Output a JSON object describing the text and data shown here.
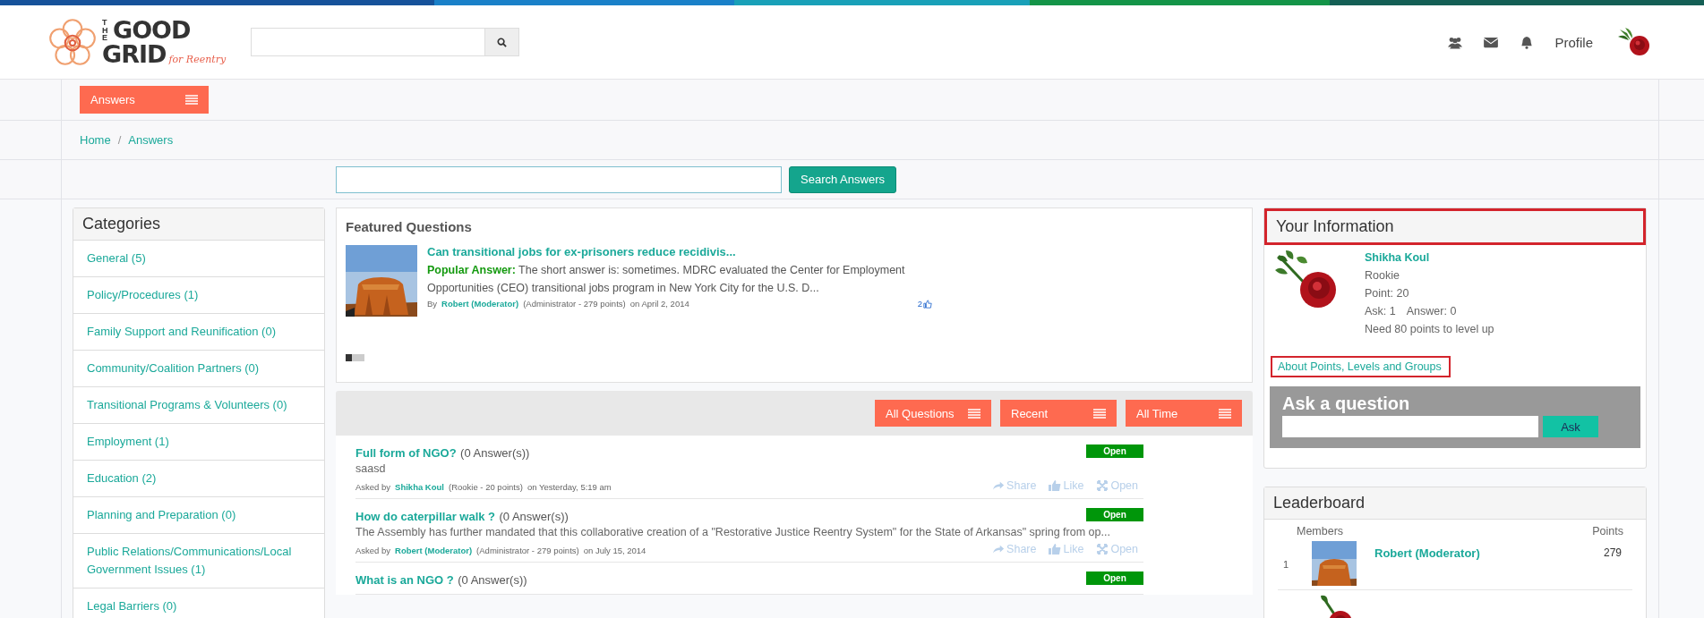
{
  "brand": {
    "top": "THE",
    "word1": "GOOD",
    "word2": "GRID",
    "tagline": "for Reentry"
  },
  "nav": {
    "profile": "Profile"
  },
  "section_button": {
    "label": "Answers"
  },
  "breadcrumb": {
    "separator": "/",
    "items": [
      "Home",
      "Answers"
    ]
  },
  "answer_search": {
    "button": "Search Answers"
  },
  "categories": {
    "title": "Categories",
    "items": [
      {
        "label": "General (5)"
      },
      {
        "label": "Policy/Procedures (1)"
      },
      {
        "label": "Family Support and Reunification (0)"
      },
      {
        "label": "Community/Coalition Partners (0)"
      },
      {
        "label": "Transitional Programs & Volunteers (0)"
      },
      {
        "label": "Employment (1)"
      },
      {
        "label": "Education (2)"
      },
      {
        "label": "Planning and Preparation (0)"
      },
      {
        "label": "Public Relations/Communications/Local Government Issues (1)"
      },
      {
        "label": "Legal Barriers (0)"
      }
    ]
  },
  "featured": {
    "title": "Featured Questions",
    "question": "Can transitional jobs for ex-prisoners reduce recidivis...",
    "answer_label": "Popular Answer:",
    "answer": "The short answer is: sometimes. MDRC evaluated the Center for Employment Opportunities (CEO) transitional jobs program in New York City for the U.S. D...",
    "by": "By",
    "author": "Robert (Moderator)",
    "role": "(Administrator - 279 points)",
    "date": "on April 2, 2014",
    "likes": "2",
    "pager": [
      {
        "selected": true
      },
      {
        "selected": false
      },
      {
        "selected": false
      }
    ]
  },
  "filters": [
    {
      "label": "All Questions"
    },
    {
      "label": "Recent"
    },
    {
      "label": "All Time"
    }
  ],
  "questions": [
    {
      "title": "Full form of NGO?",
      "count": "(0 Answer(s))",
      "excerpt": "saasd",
      "asked": "Asked by",
      "author": "Shikha Koul",
      "role": "(Rookie - 20 points)",
      "date": "on Yesterday, 5:19 am",
      "status": "Open",
      "actions": [
        "Share",
        "Like",
        "Open"
      ]
    },
    {
      "title": "How do caterpillar walk ?",
      "count": "(0 Answer(s))",
      "excerpt": "The Assembly has further mandated that this collaborative creation of a \"Restorative Justice Reentry System\" for the State of Arkansas\" spring from op...",
      "asked": "Asked by",
      "author": "Robert (Moderator)",
      "role": "(Administrator - 279 points)",
      "date": "on July 15, 2014",
      "status": "Open",
      "actions": [
        "Share",
        "Like",
        "Open"
      ]
    },
    {
      "title": "What is an NGO ?",
      "count": "(0 Answer(s))",
      "status": "Open"
    }
  ],
  "your_info": {
    "title": "Your Information",
    "name": "Shikha Koul",
    "level": "Rookie",
    "points": "Point: 20",
    "ask": "Ask: 1",
    "answer": "Answer: 0",
    "need": "Need 80 points to level up",
    "about": "About Points, Levels and Groups"
  },
  "ask_box": {
    "title": "Ask a question",
    "button": "Ask"
  },
  "leaderboard": {
    "title": "Leaderboard",
    "col_members": "Members",
    "col_points": "Points",
    "rows": [
      {
        "rank": "1",
        "name": "Robert (Moderator)",
        "points": "279",
        "kind": "picture"
      },
      {
        "kind": "picture"
      }
    ]
  }
}
